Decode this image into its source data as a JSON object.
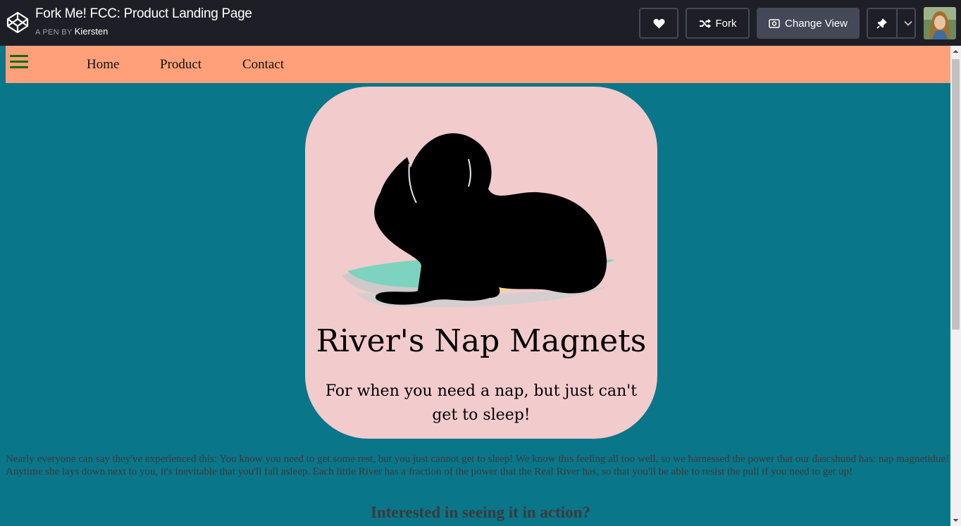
{
  "header": {
    "title": "Fork Me! FCC: Product Landing Page",
    "byline_prefix": "A PEN BY",
    "author": "Kiersten",
    "fork_label": "Fork",
    "change_view_label": "Change View"
  },
  "nav": {
    "links": [
      "Home",
      "Product",
      "Contact"
    ]
  },
  "hero": {
    "title": "River's Nap Magnets",
    "subtitle": "For when you need a nap, but just can't get to sleep!"
  },
  "content": {
    "paragraph": "Nearly everyone can say they've experienced this: You know you need to get some rest, but you just cannot get to sleep! We know this feeling all too well, so we harnessed the power that our dascshund has: nap magnetidue! Anytime she lays down next to you, it's inevitable that you'll fall asleep. Each little River has a fraction of the power that the Real River has, so that you'll be able to resist the pull if you need to get up!",
    "cta_heading": "Interested in seeing it in action?"
  },
  "colors": {
    "page_bg": "#0a7689",
    "navbar_bg": "#ffa07a",
    "hero_bg": "#f2cbcd",
    "topbar_bg": "#1e1f26"
  }
}
